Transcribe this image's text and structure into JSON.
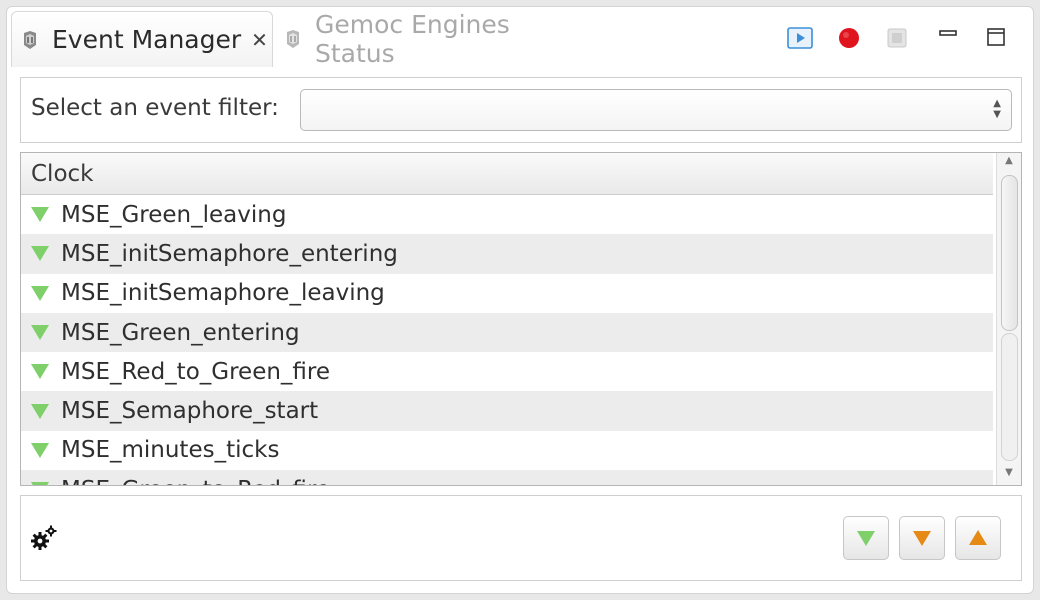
{
  "tabs": [
    {
      "label": "Event Manager",
      "active": true,
      "icon": "gemoc-logo-icon",
      "close_glyph": "✕"
    },
    {
      "label": "Gemoc Engines Status",
      "active": false,
      "icon": "gemoc-logo-icon"
    }
  ],
  "toolbar": {
    "buttons": [
      "play-icon",
      "record-icon",
      "stop-icon",
      "minimize-icon",
      "maximize-icon"
    ]
  },
  "filter": {
    "label": "Select an event filter:",
    "value": ""
  },
  "table": {
    "header": "Clock",
    "rows": [
      "MSE_Green_leaving",
      "MSE_initSemaphore_entering",
      "MSE_initSemaphore_leaving",
      "MSE_Green_entering",
      "MSE_Red_to_Green_fire",
      "MSE_Semaphore_start",
      "MSE_minutes_ticks",
      "MSE_Green_to_Red_fire"
    ]
  },
  "controls": {
    "icons": [
      "gears-icon",
      "green-down-arrow-icon",
      "orange-down-arrow-icon",
      "orange-up-arrow-icon"
    ]
  },
  "colors": {
    "green_triangle": "#7fcf6a",
    "orange_triangle": "#e58a14",
    "record_red": "#e0141e",
    "play_blue": "#3a8fd8"
  }
}
